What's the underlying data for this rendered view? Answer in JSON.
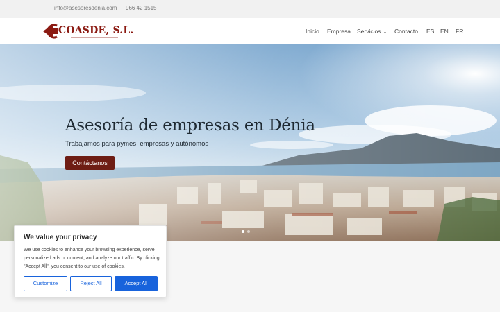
{
  "topbar": {
    "email": "info@asesoresdenia.com",
    "phone": "966 42 1515"
  },
  "header": {
    "logo_text": "COASDE, S.L.",
    "nav": [
      {
        "id": "inicio",
        "label": "Inicio"
      },
      {
        "id": "empresa",
        "label": "Empresa"
      },
      {
        "id": "servicios",
        "label": "Servicios",
        "has_dropdown": true
      },
      {
        "id": "contacto",
        "label": "Contacto"
      },
      {
        "id": "es",
        "label": "ES"
      },
      {
        "id": "en",
        "label": "EN"
      },
      {
        "id": "fr",
        "label": "FR"
      }
    ]
  },
  "hero": {
    "title": "Asesoría de empresas en Dénia",
    "subtitle": "Trabajamos para pymes, empresas y autónomos",
    "button_label": "Contáctanos",
    "slides_total": 2,
    "active_slide": 1
  },
  "cookie": {
    "title": "We value your privacy",
    "text": "We use cookies to enhance your browsing experience, serve personalized ads or content, and analyze our traffic. By clicking \"Accept All\", you consent to our use of cookies.",
    "customize_label": "Customize",
    "reject_label": "Reject All",
    "accept_label": "Accept All"
  },
  "colors": {
    "brand": "#8b1a12",
    "button": "#6e1d14",
    "cookie_accent": "#1863dc"
  },
  "icons": {
    "dropdown": "chevron-down-icon",
    "logo_mark": "logo-arrow-icon"
  }
}
